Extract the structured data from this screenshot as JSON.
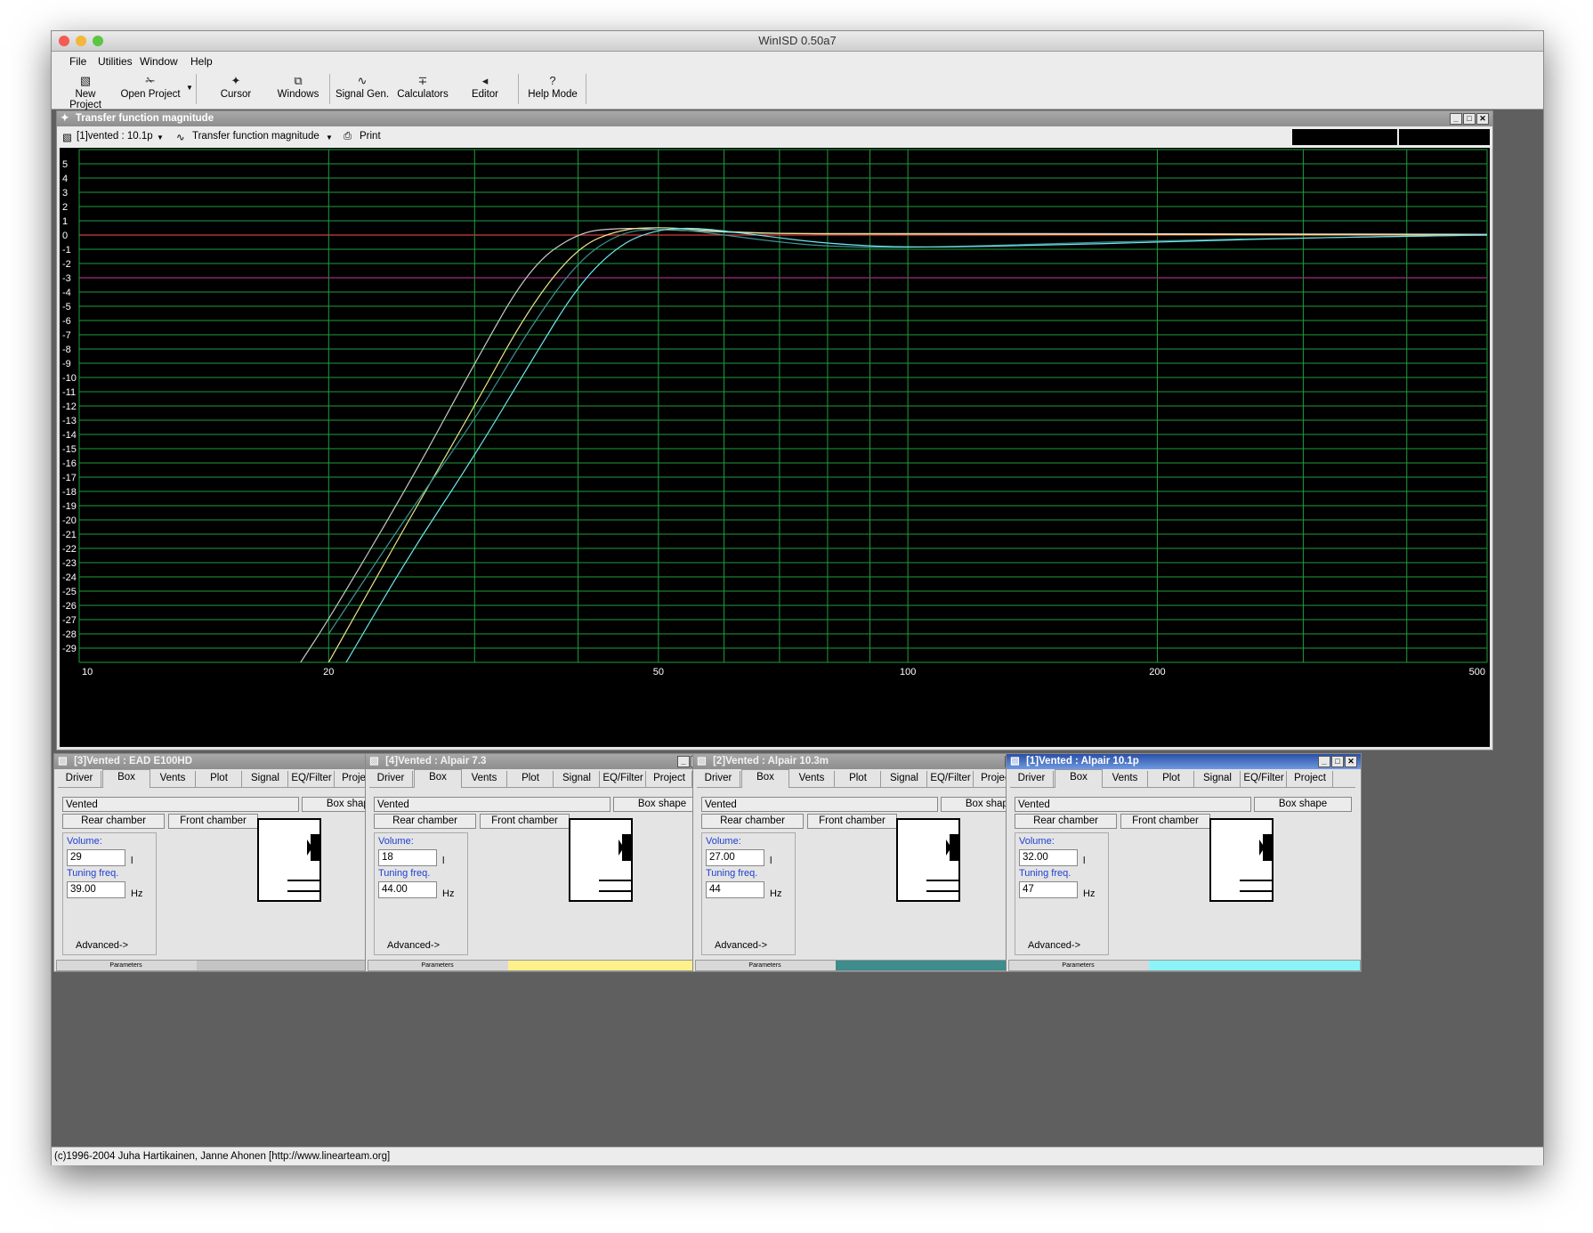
{
  "app": {
    "title": "WinISD 0.50a7",
    "menu": [
      {
        "label": "File"
      },
      {
        "label": "Utilities"
      },
      {
        "label": "Window"
      },
      {
        "label": "Help"
      }
    ],
    "toolbar": [
      {
        "label": "New Project",
        "icon": "new-project-icon"
      },
      {
        "label": "Open Project",
        "icon": "open-project-icon"
      },
      {
        "label": "Cursor",
        "icon": "cursor-icon"
      },
      {
        "label": "Windows",
        "icon": "windows-icon"
      },
      {
        "label": "Signal Gen.",
        "icon": "signal-gen-icon"
      },
      {
        "label": "Calculators",
        "icon": "calculators-icon"
      },
      {
        "label": "Editor",
        "icon": "editor-icon"
      },
      {
        "label": "Help Mode",
        "icon": "help-icon"
      }
    ],
    "status": "(c)1996-2004 Juha Hartikainen, Janne Ahonen [http://www.linearteam.org]"
  },
  "graph_window": {
    "title": "Transfer function magnitude",
    "project_select": "[1]vented : 10.1p",
    "graph_select": "Transfer function magnitude",
    "print_label": "Print"
  },
  "chart_data": {
    "type": "line",
    "title": "",
    "xlabel": "",
    "ylabel": "",
    "x_scale": "log",
    "xlim": [
      10,
      500
    ],
    "ylim": [
      -30,
      6
    ],
    "grid": true,
    "x_tick_labels": [
      "10",
      "20",
      "50",
      "100",
      "200",
      "500"
    ],
    "x_ticks": [
      10,
      20,
      50,
      100,
      200,
      500
    ],
    "x_grid": [
      10,
      20,
      30,
      40,
      50,
      60,
      70,
      80,
      90,
      100,
      200,
      300,
      400,
      500
    ],
    "y_ticks": [
      5,
      4,
      3,
      2,
      1,
      0,
      -1,
      -2,
      -3,
      -4,
      -5,
      -6,
      -7,
      -8,
      -9,
      -10,
      -11,
      -12,
      -13,
      -14,
      -15,
      -16,
      -17,
      -18,
      -19,
      -20,
      -21,
      -22,
      -23,
      -24,
      -25,
      -26,
      -27,
      -28,
      -29
    ],
    "reference_lines": [
      {
        "y": 0,
        "color": "#d23c3c"
      },
      {
        "y": -3,
        "color": "#a0307a"
      }
    ],
    "series": [
      {
        "color": "#c9c9c9",
        "x": [
          18.5,
          20,
          25,
          30,
          35,
          40,
          45,
          50,
          60,
          70,
          100,
          200,
          500
        ],
        "y": [
          -30,
          -27,
          -17.5,
          -9,
          -2.2,
          0.2,
          0.5,
          0.4,
          0.2,
          0.1,
          0.1,
          0.1,
          0.05
        ]
      },
      {
        "color": "#f0e68c",
        "x": [
          20,
          25,
          30,
          35,
          40,
          45,
          50,
          55,
          60,
          70,
          100,
          200,
          500
        ],
        "y": [
          -30,
          -20,
          -12,
          -5,
          -0.8,
          0.4,
          0.55,
          0.4,
          0.25,
          0.1,
          0.05,
          0.05,
          0.0
        ]
      },
      {
        "color": "#3e9494",
        "x": [
          20,
          25,
          30,
          35,
          40,
          45,
          50,
          55,
          60,
          70,
          80,
          100,
          150,
          200,
          300,
          500
        ],
        "y": [
          -28,
          -19.5,
          -13,
          -6.5,
          -1.8,
          0.2,
          0.45,
          0.3,
          0.0,
          -0.5,
          -0.8,
          -0.9,
          -0.6,
          -0.4,
          -0.2,
          0.0
        ]
      },
      {
        "color": "#70e6ee",
        "x": [
          21,
          25,
          30,
          35,
          40,
          45,
          50,
          55,
          60,
          70,
          80,
          100,
          150,
          200,
          300,
          500
        ],
        "y": [
          -30,
          -22.5,
          -15.5,
          -9,
          -3.5,
          -0.6,
          0.4,
          0.5,
          0.3,
          -0.2,
          -0.6,
          -0.9,
          -0.7,
          -0.5,
          -0.2,
          0.0
        ]
      }
    ]
  },
  "tabs": [
    "Driver",
    "Box",
    "Vents",
    "Plot",
    "Signal",
    "EQ/Filter",
    "Project"
  ],
  "panel_labels": {
    "box_type": "Vented",
    "box_shape": "Box shape",
    "rear_chamber": "Rear chamber",
    "front_chamber": "Front chamber",
    "volume": "Volume:",
    "volume_unit": "l",
    "tuning": "Tuning freq.",
    "tuning_unit": "Hz",
    "advanced": "Advanced->",
    "parameters": "Parameters"
  },
  "panels": [
    {
      "title": "[3]Vented : EAD E100HD",
      "volume": "29",
      "tuning": "39.00",
      "color": "#c4c4c4",
      "active": false
    },
    {
      "title": "[4]Vented : Alpair 7.3",
      "volume": "18",
      "tuning": "44.00",
      "color": "#fff08c",
      "active": false
    },
    {
      "title": "[2]Vented : Alpair 10.3m",
      "volume": "27.00",
      "tuning": "44",
      "color": "#3e8c8c",
      "active": false
    },
    {
      "title": "[1]Vented : Alpair 10.1p",
      "volume": "32.00",
      "tuning": "47",
      "color": "#8cf4f8",
      "active": true
    }
  ]
}
